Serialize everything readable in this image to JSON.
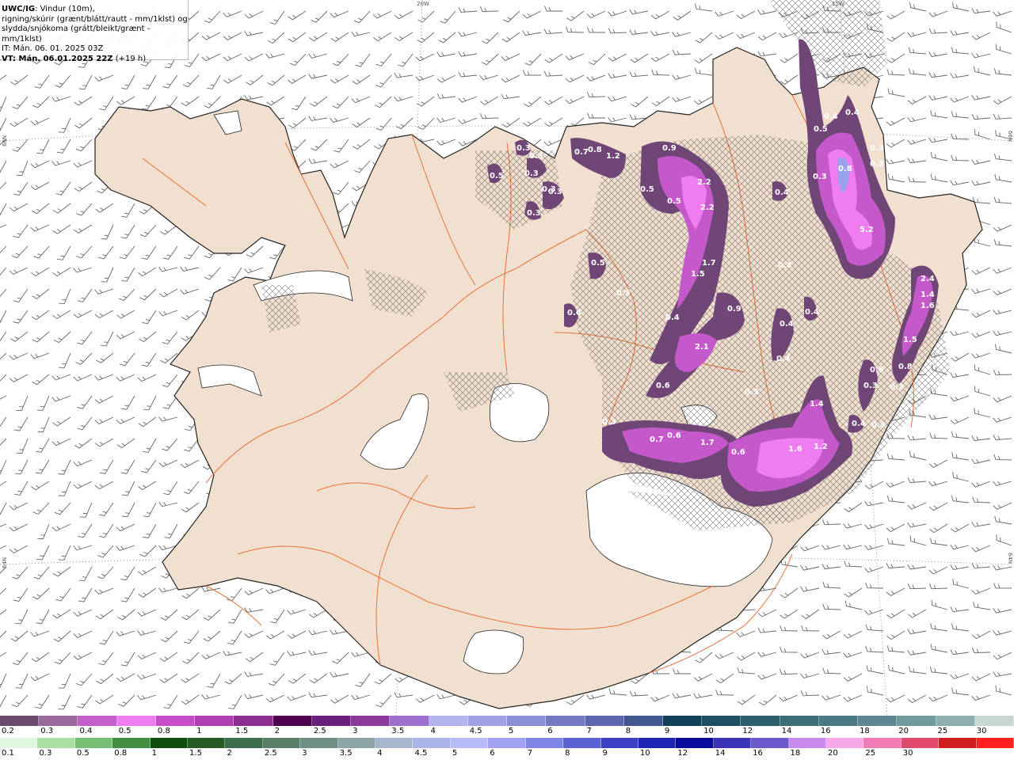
{
  "header": {
    "product": "UWC/IG",
    "line1_rest": ": Vindur (10m),",
    "line2": "rigning/skúrir (grænt/blátt/rautt - mm/1klst) og",
    "line3": "slydda/snjókoma (grátt/bleikt/grænt - mm/1klst)",
    "line4": "IT: Mán. 06. 01. 2025 03Z",
    "line5_bold": "VT: Mán. 06.01.2025 22Z",
    "line5_rest": " (+19 h)"
  },
  "graticule": {
    "lon_top": [
      "20W",
      "15W"
    ],
    "lat_left": [
      "66N",
      "64N"
    ],
    "lat_right": [
      "66N",
      "64N"
    ]
  },
  "precip_labels": [
    "0.5",
    "0.3",
    "0.3",
    "0.3",
    "0.3",
    "0.3",
    "0.3",
    "0.5",
    "0.7",
    "0.8",
    "1.2",
    "0.9",
    "0.5",
    "0.5",
    "2.2",
    "2.2",
    "0.5",
    "1.7",
    "1.5",
    "0.6",
    "0.4",
    "0.9",
    "2.1",
    "0.6",
    "0.3",
    "0.7",
    "0.6",
    "1.7",
    "0.6",
    "1.6",
    "1.2",
    "1.4",
    "0.3",
    "0.4",
    "0.4",
    "0.4",
    "0.4",
    "0.4",
    "0.4",
    "0.4",
    "0.4",
    "0.5",
    "0.3",
    "0.8",
    "5.2",
    "2.4",
    "1.4",
    "1.6",
    "1.5",
    "0.8",
    "0.6",
    "0.3",
    "0.3",
    "0.3",
    "0.3",
    "0.4"
  ],
  "colors": {
    "land": "#f1e0cf",
    "coast": "#222222",
    "roads": "#e8703a",
    "sea": "#ffffff",
    "glacier": "#ffffff",
    "precip_light": "#6f4675",
    "precip_mid": "#9b3fa6",
    "precip_bright": "#e37de8",
    "precip_core": "#9aa0ee"
  },
  "legend": {
    "snow_colors": [
      "#6b4a6b",
      "#9b6a9d",
      "#c45ec9",
      "#ef7cf0",
      "#c74ec8",
      "#b13fb3",
      "#8e2d90",
      "#4d004d",
      "#6a1f7a",
      "#8a3a9a",
      "#9f6fd0",
      "#b2b4ef",
      "#9fa1e4",
      "#8a8fd6",
      "#7479c2",
      "#5d66ad",
      "#43578f",
      "#11405a",
      "#1e4f62",
      "#2c5f6c",
      "#3b6c77",
      "#4c7a84",
      "#5d8891",
      "#719a9f",
      "#8eb0b1",
      "#c8d6d4"
    ],
    "snow_labels": [
      "0.2",
      "0.3",
      "0.4",
      "0.5",
      "0.8",
      "1",
      "1.5",
      "2",
      "2.5",
      "3",
      "3.5",
      "4",
      "4.5",
      "5",
      "6",
      "7",
      "8",
      "9",
      "10",
      "12",
      "14",
      "16",
      "18",
      "20",
      "25",
      "30"
    ],
    "rain_colors": [
      "#dff8df",
      "#a8dfa4",
      "#75be73",
      "#3f8f3f",
      "#0e4d0e",
      "#245c24",
      "#3b6f4c",
      "#587f65",
      "#6f8f86",
      "#8ea6a9",
      "#a5b6cd",
      "#a9b5e8",
      "#b6bbf7",
      "#9ea2f0",
      "#7f86e5",
      "#5a63d6",
      "#3b40c4",
      "#1d24b2",
      "#0a0a9c",
      "#3b34b8",
      "#6b58cc",
      "#c98bf0",
      "#f5a8e8",
      "#f07bb5",
      "#e04a6a",
      "#d01e1e",
      "#ff2020"
    ],
    "rain_labels": [
      "0.1",
      "0.3",
      "0.5",
      "0.8",
      "1",
      "1.5",
      "2",
      "2.5",
      "3",
      "3.5",
      "4",
      "4.5",
      "5",
      "6",
      "7",
      "8",
      "9",
      "10",
      "12",
      "14",
      "16",
      "18",
      "20",
      "25",
      "30"
    ]
  }
}
